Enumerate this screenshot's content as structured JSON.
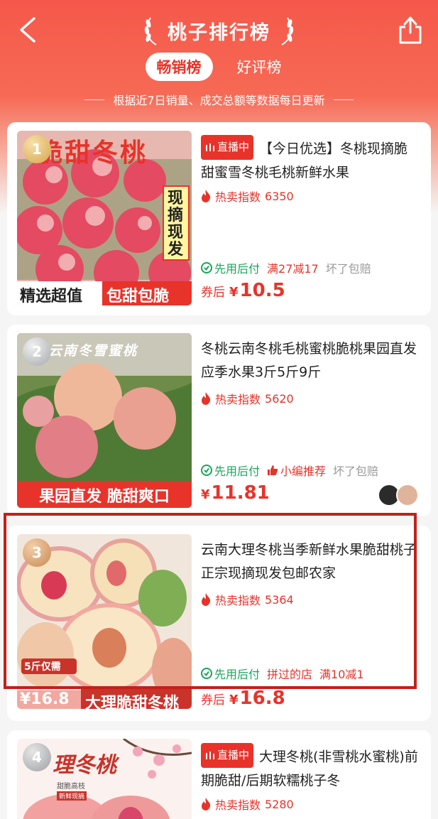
{
  "header": {
    "title": "桃子排行榜",
    "tabs": [
      {
        "label": "畅销榜",
        "active": true
      },
      {
        "label": "好评榜",
        "active": false
      }
    ],
    "subtitle": "根据近7日销量、成交总额等数据每日更新",
    "accent": "#e8332a"
  },
  "products": [
    {
      "rank": "1",
      "live_badge": "直播中",
      "title": "【今日优选】冬桃现摘脆甜蜜雪冬桃毛桃新鲜水果",
      "hot_label": "热卖指数",
      "hot_value": "6350",
      "tags": [
        "先用后付",
        "满27减17",
        "坏了包赔"
      ],
      "price_prefix": "券后",
      "currency": "¥",
      "price": "10.5",
      "image_text": {
        "top": "脆甜冬桃",
        "side": "现摘现发",
        "bottom_left": "精选超值",
        "bottom_right": "包甜包脆"
      }
    },
    {
      "rank": "2",
      "title": "冬桃云南冬桃毛桃蜜桃脆桃果园直发应季水果3斤5斤9斤",
      "hot_label": "热卖指数",
      "hot_value": "5620",
      "tags": [
        "先用后付",
        "小编推荐",
        "坏了包赔"
      ],
      "currency": "¥",
      "price": "11.81",
      "image_text": {
        "top": "云南冬雪蜜桃",
        "bottom": "果园直发 脆甜爽口"
      }
    },
    {
      "rank": "3",
      "title": "云南大理冬桃当季新鲜水果脆甜桃子正宗现摘现发包邮农家",
      "hot_label": "热卖指数",
      "hot_value": "5364",
      "tags": [
        "先用后付",
        "拼过的店",
        "满10减1"
      ],
      "price_prefix": "券后",
      "currency": "¥",
      "price": "16.8",
      "image_text": {
        "badge": "5斤仅需",
        "price": "¥16.8",
        "bottom": "大理脆甜冬桃"
      }
    },
    {
      "rank": "4",
      "live_badge": "直播中",
      "title": "大理冬桃(非雪桃水蜜桃)前期脆甜/后期软糯桃子冬",
      "hot_label": "热卖指数",
      "hot_value": "5280",
      "image_text": {
        "top": "理冬桃",
        "small1": "甜脆高枝",
        "small2": "新鲜现摘"
      }
    }
  ]
}
